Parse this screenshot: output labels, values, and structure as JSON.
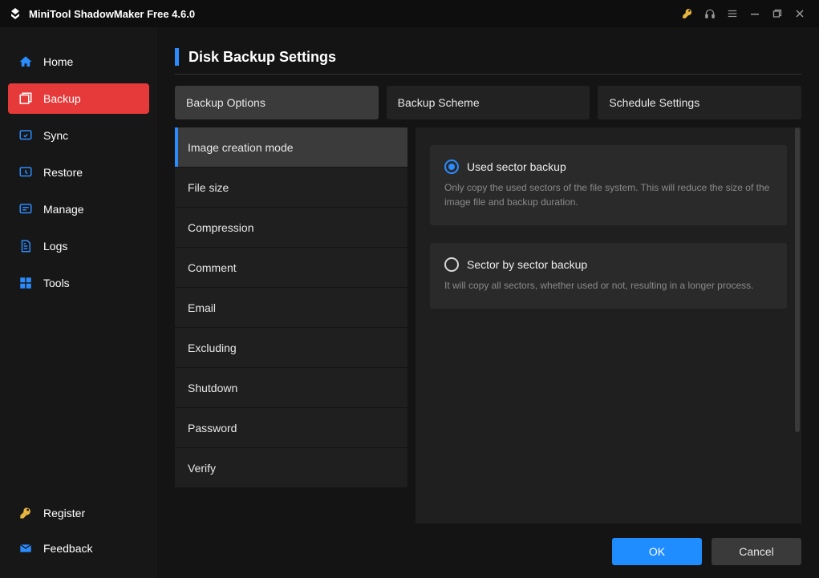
{
  "titlebar": {
    "appName": "MiniTool ShadowMaker Free 4.6.0"
  },
  "sidebar": {
    "items": [
      {
        "label": "Home"
      },
      {
        "label": "Backup"
      },
      {
        "label": "Sync"
      },
      {
        "label": "Restore"
      },
      {
        "label": "Manage"
      },
      {
        "label": "Logs"
      },
      {
        "label": "Tools"
      }
    ],
    "activeIndex": 1,
    "bottom": {
      "register": "Register",
      "feedback": "Feedback"
    }
  },
  "page": {
    "title": "Disk Backup Settings",
    "tabs": [
      {
        "label": "Backup Options"
      },
      {
        "label": "Backup Scheme"
      },
      {
        "label": "Schedule Settings"
      }
    ],
    "activeTab": 0,
    "optionsList": [
      {
        "label": "Image creation mode"
      },
      {
        "label": "File size"
      },
      {
        "label": "Compression"
      },
      {
        "label": "Comment"
      },
      {
        "label": "Email"
      },
      {
        "label": "Excluding"
      },
      {
        "label": "Shutdown"
      },
      {
        "label": "Password"
      },
      {
        "label": "Verify"
      }
    ],
    "activeOption": 0,
    "radioOptions": [
      {
        "label": "Used sector backup",
        "desc": "Only copy the used sectors of the file system. This will reduce the size of the image file and backup duration.",
        "selected": true
      },
      {
        "label": "Sector by sector backup",
        "desc": "It will copy all sectors, whether used or not, resulting in a longer process.",
        "selected": false
      }
    ],
    "buttons": {
      "ok": "OK",
      "cancel": "Cancel"
    }
  }
}
